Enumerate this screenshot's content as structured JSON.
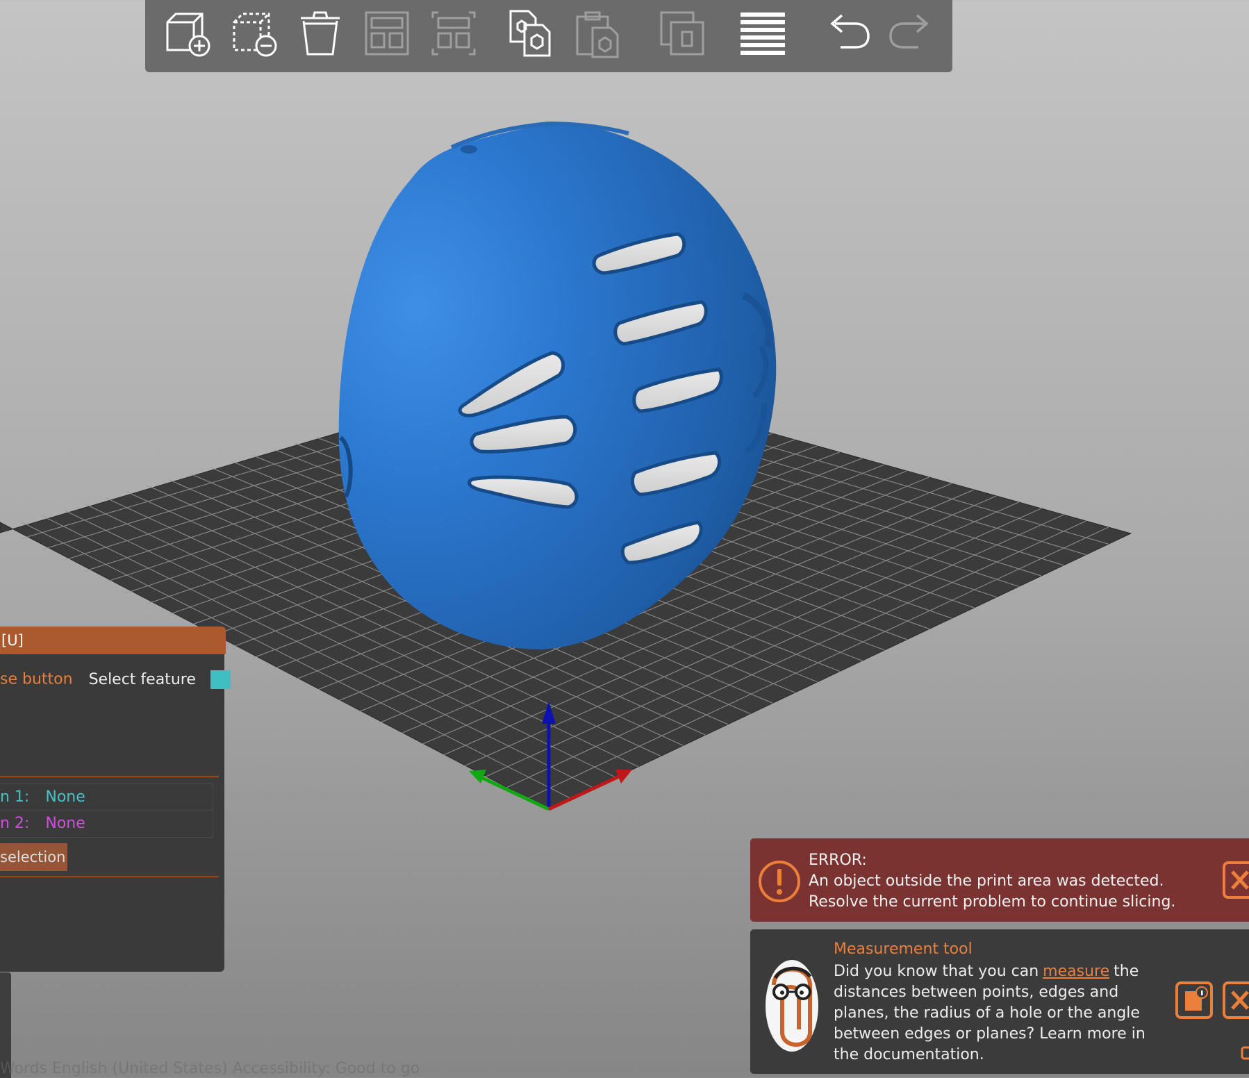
{
  "toolbar": {
    "buttons": [
      {
        "name": "add-object-icon",
        "enabled": true
      },
      {
        "name": "remove-object-icon",
        "enabled": true
      },
      {
        "name": "delete-all-icon",
        "enabled": true
      },
      {
        "name": "arrange-icon",
        "enabled": false
      },
      {
        "name": "arrange-selection-icon",
        "enabled": false
      },
      {
        "name": "copy-icon",
        "enabled": true
      },
      {
        "name": "paste-icon",
        "enabled": false
      },
      {
        "name": "add-instance-icon",
        "enabled": false
      },
      {
        "name": "layers-editing-icon",
        "enabled": true
      },
      {
        "name": "undo-icon",
        "enabled": true
      },
      {
        "name": "redo-icon",
        "enabled": false
      }
    ]
  },
  "measure_panel": {
    "header": "[U]",
    "mouse_button_label": "se button",
    "action_label": "Select feature",
    "feature_color": "#3fbfc0",
    "selection1_label": "n 1:",
    "selection1_value": "None",
    "selection2_label": "n 2:",
    "selection2_value": "None",
    "restart_label": "selection"
  },
  "status_bar_text": "Words     English (United States)     Accessibility: Good to go",
  "error": {
    "title": "ERROR:",
    "line1": "An object outside the print area was detected.",
    "line2": "Resolve the current problem to continue slicing."
  },
  "hint": {
    "title": "Measurement tool",
    "before_link": "Did you know that you can",
    "link": "measure",
    "after_link": "the distances between points, edges and planes, the radius of a hole or the angle between edges or planes? Learn more in the documentation."
  },
  "colors": {
    "accent_orange": "#ec7f39",
    "model_blue": "#2b73c4",
    "bed_dark": "#3b3b3b",
    "error_bg": "#7b3332"
  }
}
